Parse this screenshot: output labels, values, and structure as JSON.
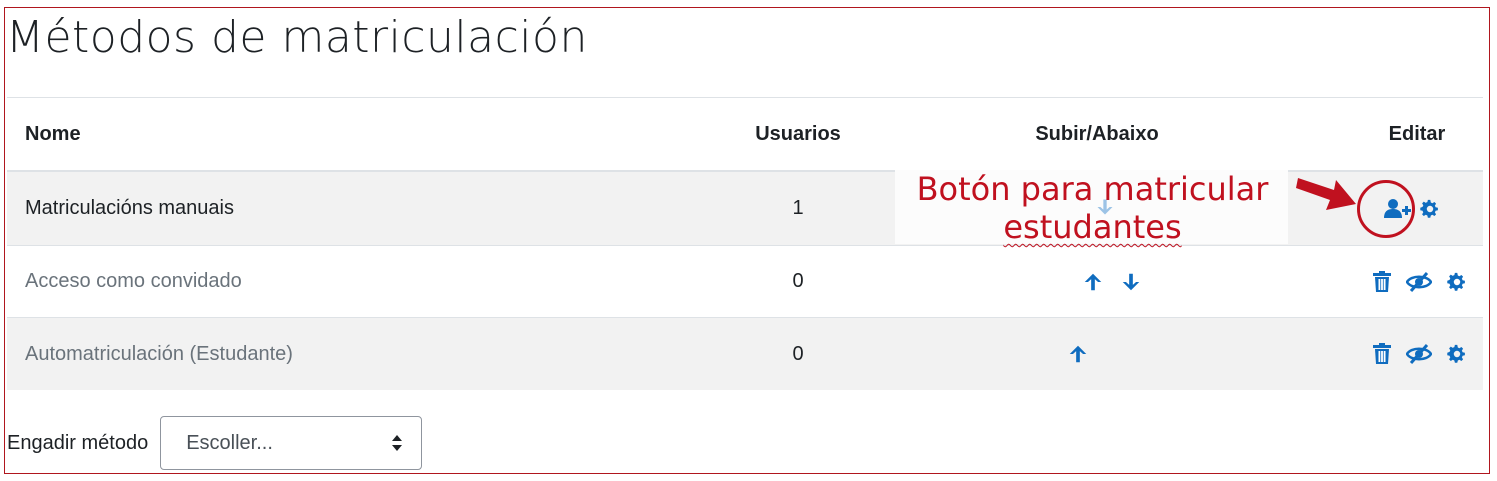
{
  "page_title": "Métodos de matriculación",
  "table": {
    "headers": {
      "name": "Nome",
      "users": "Usuarios",
      "move": "Subir/Abaixo",
      "edit": "Editar"
    },
    "rows": [
      {
        "name": "Matriculacións manuais",
        "users": "1",
        "state": "enabled"
      },
      {
        "name": "Acceso como convidado",
        "users": "0",
        "state": "disabled"
      },
      {
        "name": "Automatriculación (Estudante)",
        "users": "0",
        "state": "disabled"
      }
    ]
  },
  "add_method": {
    "label": "Engadir método",
    "select_value": "Escoller..."
  },
  "annotation": {
    "line1": "Botón para matricular",
    "line2": "estudantes"
  },
  "icons": {
    "up": "arrow-up-icon",
    "down": "arrow-down-icon",
    "delete": "trash-icon",
    "visibility": "eye-slash-icon",
    "settings": "gear-icon",
    "enrol": "user-plus-icon",
    "select": "sort-caret-icon",
    "pointer": "red-arrow-icon"
  },
  "colors": {
    "accent": "#0f6cbf",
    "annotation": "#c0111f",
    "muted_text": "#6a737b",
    "row_alt": "#f2f2f2"
  }
}
